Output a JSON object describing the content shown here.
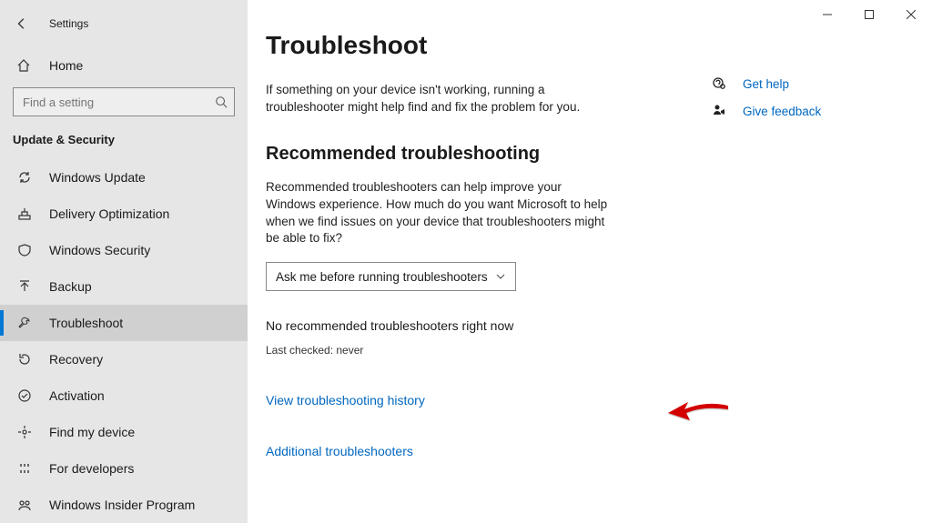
{
  "app": {
    "title": "Settings"
  },
  "sidebar": {
    "home_label": "Home",
    "search_placeholder": "Find a setting",
    "category": "Update & Security",
    "items": [
      {
        "label": "Windows Update"
      },
      {
        "label": "Delivery Optimization"
      },
      {
        "label": "Windows Security"
      },
      {
        "label": "Backup"
      },
      {
        "label": "Troubleshoot"
      },
      {
        "label": "Recovery"
      },
      {
        "label": "Activation"
      },
      {
        "label": "Find my device"
      },
      {
        "label": "For developers"
      },
      {
        "label": "Windows Insider Program"
      }
    ]
  },
  "main": {
    "title": "Troubleshoot",
    "intro": "If something on your device isn't working, running a troubleshooter might help find and fix the problem for you.",
    "section_heading": "Recommended troubleshooting",
    "section_desc": "Recommended troubleshooters can help improve your Windows experience. How much do you want Microsoft to help when we find issues on your device that troubleshooters might be able to fix?",
    "select_value": "Ask me before running troubleshooters",
    "status": "No recommended troubleshooters right now",
    "last_checked": "Last checked: never",
    "link_history": "View troubleshooting history",
    "link_additional": "Additional troubleshooters"
  },
  "aside": {
    "get_help": "Get help",
    "give_feedback": "Give feedback"
  }
}
